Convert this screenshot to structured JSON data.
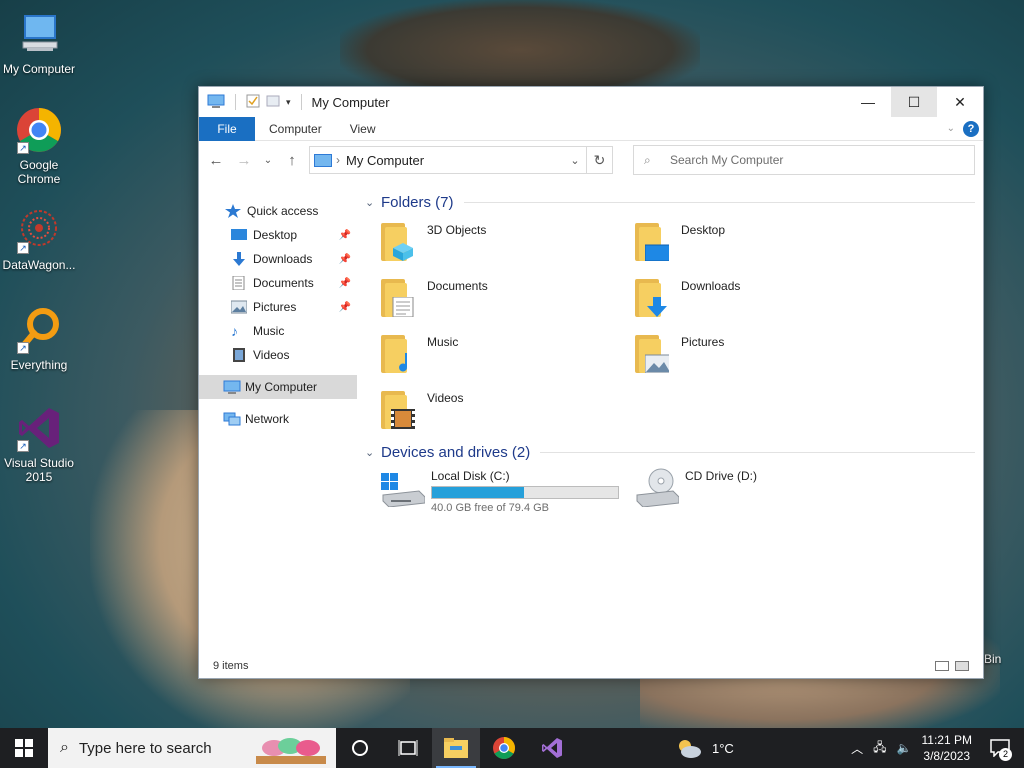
{
  "desktop": {
    "icons": [
      {
        "label": "My Computer"
      },
      {
        "label": "Google Chrome"
      },
      {
        "label": "DataWagon..."
      },
      {
        "label": "Everything"
      },
      {
        "label": "Visual Studio 2015"
      }
    ],
    "recycle_partial": "Bin"
  },
  "window": {
    "title": "My Computer",
    "ribbon": {
      "file": "File",
      "tabs": [
        "Computer",
        "View"
      ]
    },
    "address": {
      "crumb": "My Computer"
    },
    "search": {
      "placeholder": "Search My Computer"
    },
    "nav": {
      "quick_access": "Quick access",
      "items": [
        "Desktop",
        "Downloads",
        "Documents",
        "Pictures",
        "Music",
        "Videos"
      ],
      "my_computer": "My Computer",
      "network": "Network"
    },
    "folders_header": "Folders (7)",
    "folders": [
      "3D Objects",
      "Desktop",
      "Documents",
      "Downloads",
      "Music",
      "Pictures",
      "Videos"
    ],
    "devices_header": "Devices and drives (2)",
    "drives": [
      {
        "name": "Local Disk (C:)",
        "free": "40.0 GB free of 79.4 GB",
        "used_fraction": 0.496
      },
      {
        "name": "CD Drive (D:)"
      }
    ],
    "status": "9 items"
  },
  "taskbar": {
    "search_placeholder": "Type here to search",
    "weather": "1°C",
    "time": "11:21 PM",
    "date": "3/8/2023",
    "notifications": "2"
  }
}
